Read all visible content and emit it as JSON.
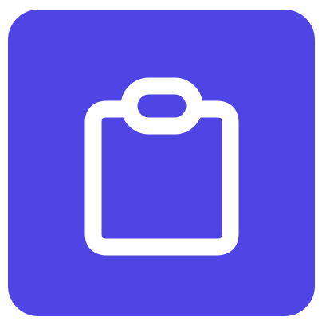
{
  "app_icon": {
    "icon": "clipboard-icon",
    "background_color": "#4f45e5",
    "glyph_color": "#ffffff"
  }
}
